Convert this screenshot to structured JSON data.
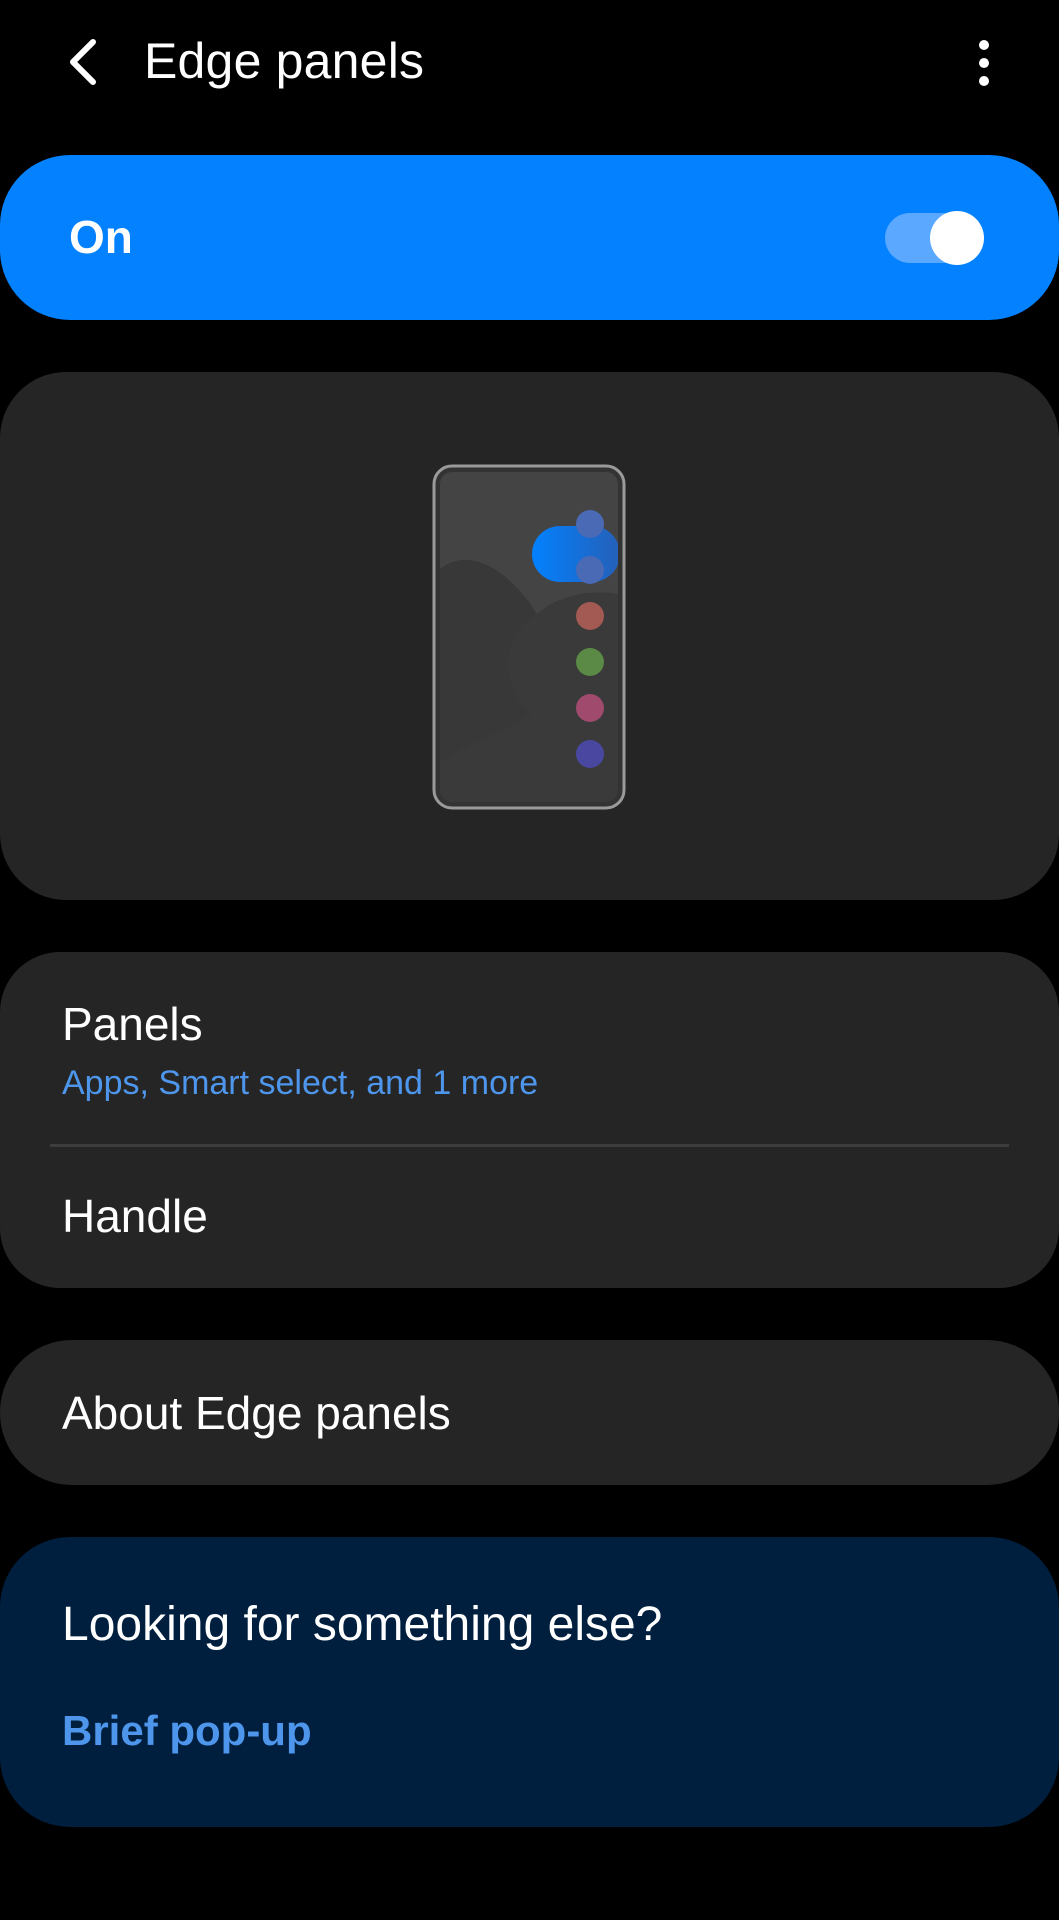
{
  "header": {
    "title": "Edge panels",
    "back_icon": "chevron-left-icon",
    "more_icon": "more-vertical-icon"
  },
  "master_switch": {
    "label": "On",
    "state": true,
    "color": "#0381fe"
  },
  "illustration": {
    "description_icon": "edge-panel-illustration",
    "dot_colors": [
      "#4a6ab5",
      "#4a6ab5",
      "#a25a52",
      "#5a8a45",
      "#a04a6e",
      "#4a47a0"
    ],
    "handle_color": "#0381fe"
  },
  "settings": {
    "items": [
      {
        "label": "Panels",
        "summary": "Apps, Smart select, and 1 more"
      },
      {
        "label": "Handle"
      }
    ]
  },
  "about": {
    "label": "About Edge panels"
  },
  "suggestions": {
    "title": "Looking for something else?",
    "link": "Brief pop-up"
  },
  "colors": {
    "background": "#000000",
    "card": "#252525",
    "accent_text": "#4d96ec",
    "suggestion_bg": "#001f3f"
  }
}
